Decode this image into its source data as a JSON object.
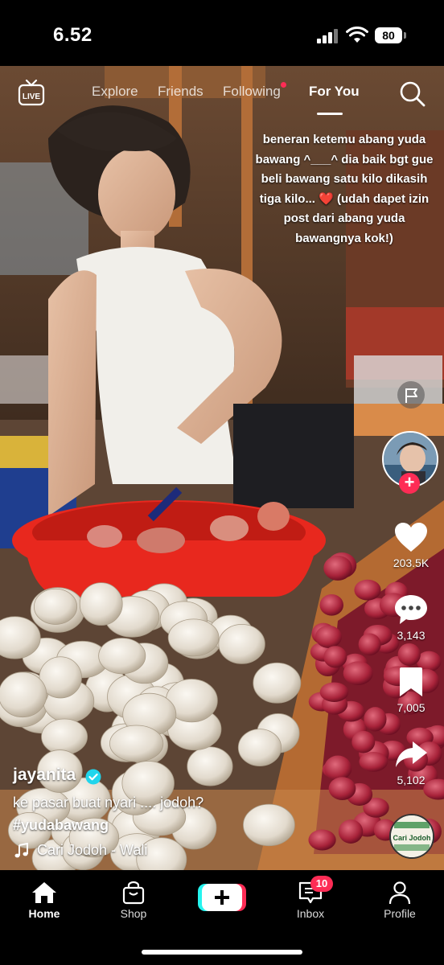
{
  "status_bar": {
    "time": "6.52",
    "battery": "80"
  },
  "top_nav": {
    "live_label": "LIVE",
    "tabs": [
      {
        "label": "Explore",
        "active": false
      },
      {
        "label": "Friends",
        "active": false
      },
      {
        "label": "Following",
        "active": false,
        "dot": true
      },
      {
        "label": "For You",
        "active": true
      }
    ]
  },
  "video": {
    "overlay_caption": "beneran ketemu abang yuda bawang ^___^ dia baik bgt gue beli bawang satu kilo dikasih tiga kilo...",
    "overlay_caption_emoji": "❤️",
    "overlay_caption_tail": "(udah dapet izin post dari abang yuda bawangnya kok!)"
  },
  "actions": {
    "likes": "203.5K",
    "comments": "3,143",
    "saves": "7,005",
    "shares": "5,102"
  },
  "post": {
    "username": "jayanita",
    "description": "ke pasar buat nyari .... jodoh?",
    "hashtag": "#yudabawang",
    "sound": "Cari Jodoh - Wali",
    "disc_text": "Cari Jodoh"
  },
  "bottom_nav": {
    "items": [
      {
        "label": "Home",
        "active": true
      },
      {
        "label": "Shop",
        "active": false
      },
      {
        "label": "Inbox",
        "active": false
      },
      {
        "label": "Profile",
        "active": false
      }
    ],
    "inbox_badge": "10"
  },
  "colors": {
    "accent": "#fe2c55",
    "verified": "#20d5ec",
    "basin": "#e8281e"
  }
}
